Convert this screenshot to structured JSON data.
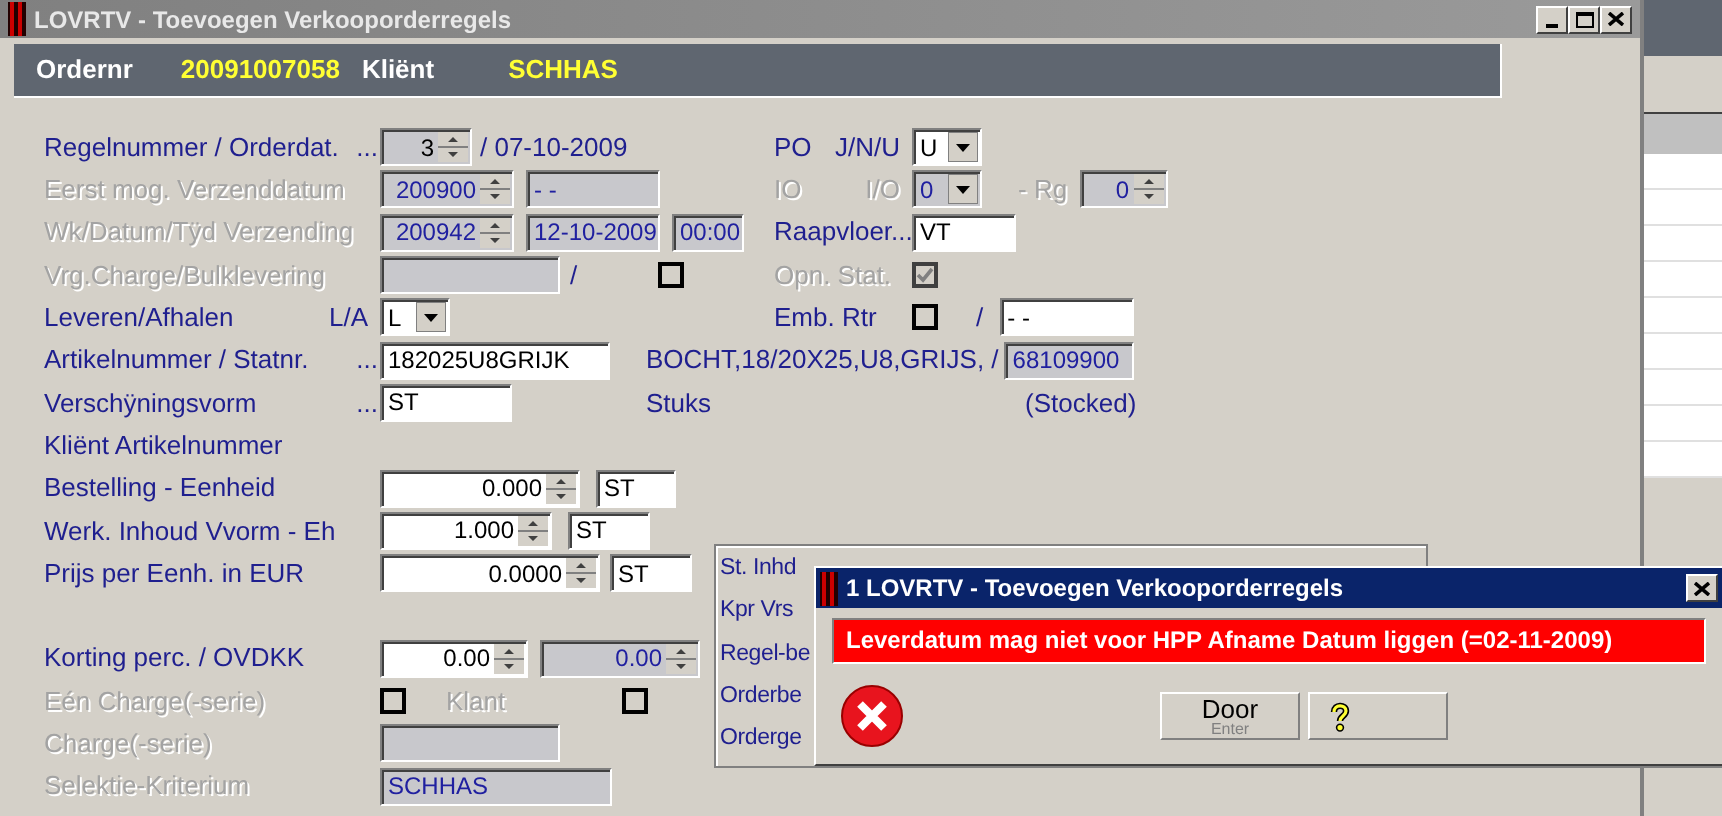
{
  "window": {
    "title": "LOVRTV - Toevoegen Verkooporderregels"
  },
  "header": {
    "order_label": "Ordernr",
    "order_number": "20091007058",
    "client_label": "Kliënt",
    "client": "SCHHAS"
  },
  "rows": [
    {
      "label": "Regelnummer / Orderdat.",
      "disabled": false,
      "lookup": "...",
      "controls": [
        {
          "kind": "spin",
          "value": "3",
          "readonly": true,
          "disabled": false
        },
        {
          "kind": "text",
          "text": "/ 07-10-2009",
          "disabled": false
        }
      ],
      "right": {
        "label": "PO",
        "sublabel": "J/N/U",
        "disabled": false,
        "controls": [
          {
            "kind": "select",
            "value": "U",
            "disabled": false
          }
        ]
      }
    },
    {
      "label": "Eerst mog. Verzenddatum",
      "disabled": true,
      "controls": [
        {
          "kind": "spin",
          "value": "200900",
          "disabled": true
        },
        {
          "kind": "input",
          "value": " - -",
          "disabled": true
        }
      ],
      "right": {
        "label": "IO",
        "sublabel": "I/O",
        "disabled": true,
        "controls": [
          {
            "kind": "select",
            "value": "0",
            "disabled": true
          },
          {
            "kind": "text",
            "text": "- Rg",
            "disabled": true
          },
          {
            "kind": "spin",
            "value": "0",
            "disabled": true
          }
        ]
      }
    },
    {
      "label": "Wk/Datum/Tÿd Verzending",
      "disabled": true,
      "controls": [
        {
          "kind": "spin",
          "value": "200942",
          "disabled": true
        },
        {
          "kind": "input",
          "value": "12-10-2009",
          "disabled": true
        },
        {
          "kind": "input",
          "value": "00:00",
          "disabled": true
        }
      ],
      "right": {
        "label": "Raapvloer...",
        "disabled": false,
        "controls": [
          {
            "kind": "input",
            "value": "VT",
            "disabled": false
          }
        ]
      }
    },
    {
      "label": "Vrg.Charge/Bulklevering",
      "disabled": true,
      "controls": [
        {
          "kind": "input",
          "disabled": true
        },
        {
          "kind": "text",
          "text": "/",
          "disabled": false
        },
        {
          "kind": "check",
          "checked": false,
          "disabled": false
        }
      ],
      "right": {
        "label": "Opn. Stat.",
        "disabled": true,
        "controls": [
          {
            "kind": "check",
            "checked": true,
            "disabled": true
          }
        ]
      }
    },
    {
      "label": "Leveren/Afhalen",
      "code": "L/A",
      "disabled": false,
      "controls": [
        {
          "kind": "select",
          "value": "L",
          "disabled": false
        }
      ],
      "right": {
        "label": "Emb. Rtr",
        "disabled": false,
        "controls": [
          {
            "kind": "check",
            "checked": false,
            "disabled": false
          },
          {
            "kind": "text",
            "text": "/",
            "disabled": false
          },
          {
            "kind": "input",
            "value": " - -",
            "disabled": false
          }
        ]
      }
    },
    {
      "label": "Artikelnummer / Statnr.",
      "disabled": false,
      "lookup": "...",
      "controls": [
        {
          "kind": "input",
          "value": "182025U8GRIJK",
          "disabled": false
        },
        {
          "kind": "text",
          "text": "BOCHT,18/20X25,U8,GRIJS, /",
          "disabled": false
        },
        {
          "kind": "input",
          "value": "68109900",
          "disabled": true
        }
      ]
    },
    {
      "label": "Verschÿningsvorm",
      "disabled": false,
      "lookup": "...",
      "controls": [
        {
          "kind": "input",
          "value": "ST",
          "disabled": false
        },
        {
          "kind": "text",
          "text": "Stuks",
          "disabled": false
        },
        {
          "kind": "text",
          "text": "(Stocked)",
          "disabled": false
        }
      ]
    },
    {
      "label": "Kliënt Artikelnummer",
      "disabled": false,
      "controls": []
    },
    {
      "label": "Bestelling - Eenheid",
      "disabled": false,
      "controls": [
        {
          "kind": "spin",
          "value": "0.000",
          "readonly": false,
          "disabled": false
        },
        {
          "kind": "input",
          "value": "ST",
          "disabled": false
        }
      ]
    },
    {
      "label": "Werk. Inhoud Vvorm - Eh",
      "disabled": false,
      "controls": [
        {
          "kind": "spin",
          "value": "1.000",
          "readonly": false,
          "disabled": false
        },
        {
          "kind": "input",
          "value": "ST",
          "disabled": false
        }
      ]
    }
  ],
  "lower_rows": [
    {
      "label": "Prijs per Eenh. in EUR",
      "disabled": false,
      "controls": [
        {
          "kind": "spin",
          "value": "0.0000",
          "readonly": false,
          "disabled": false
        },
        {
          "kind": "input",
          "value": "ST",
          "disabled": false
        }
      ]
    },
    {
      "label": "Korting perc. / OVDKK",
      "disabled": false,
      "controls": [
        {
          "kind": "spin",
          "value": "0.00",
          "readonly": false,
          "disabled": false
        },
        {
          "kind": "spin",
          "value": "0.00",
          "disabled": true
        }
      ]
    },
    {
      "label": "Eén Charge(-serie)",
      "disabled": true,
      "controls": [
        {
          "kind": "check",
          "checked": false,
          "disabled": false
        },
        {
          "kind": "text",
          "text": "Klant",
          "disabled": true
        },
        {
          "kind": "check",
          "checked": false,
          "disabled": false
        }
      ]
    },
    {
      "label": "Charge(-serie)",
      "disabled": true,
      "controls": [
        {
          "kind": "input",
          "disabled": true
        }
      ]
    },
    {
      "label": "Selektie-Kriterium",
      "disabled": true,
      "controls": [
        {
          "kind": "input",
          "value": "SCHHAS",
          "disabled": true
        }
      ]
    }
  ],
  "panel": {
    "lines": [
      "St. Inhd",
      "Kpr Vrs",
      "Regel-be",
      "Orderbe",
      "Orderge"
    ]
  },
  "dialog": {
    "title": "1 LOVRTV - Toevoegen Verkooporderregels",
    "message": "Leverdatum mag niet voor HPP Afname Datum liggen (=02-11-2009)",
    "buttons": [
      {
        "kind": "text",
        "label": "Door",
        "shortcut": "Enter"
      },
      {
        "kind": "help"
      }
    ]
  }
}
